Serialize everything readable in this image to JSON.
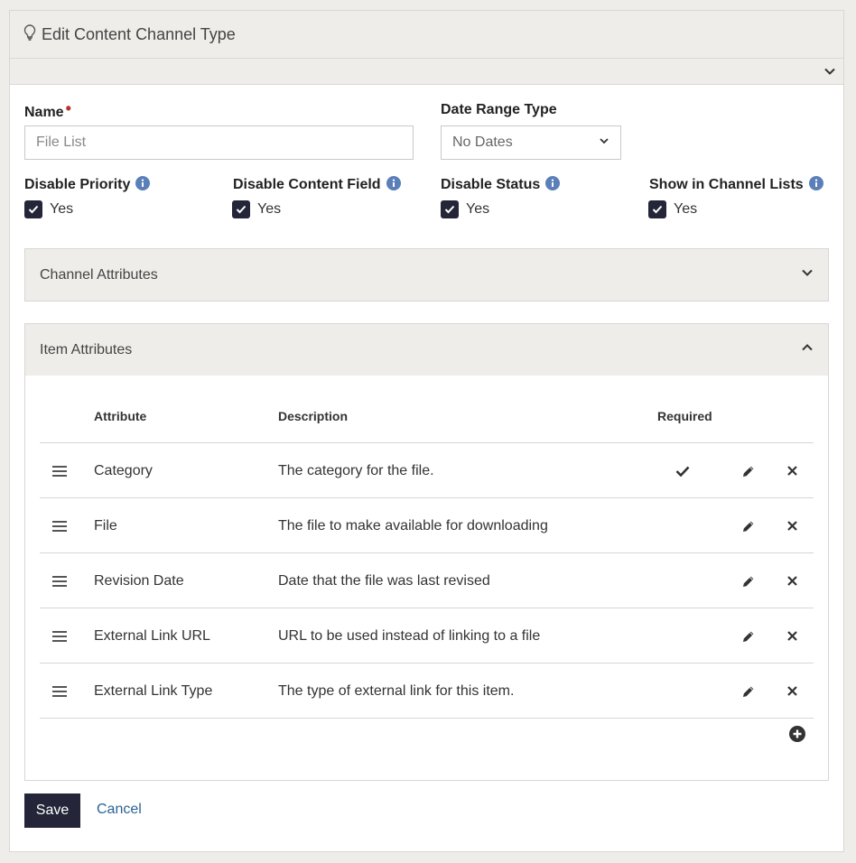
{
  "header": {
    "title": "Edit Content Channel Type",
    "icon": "lightbulb-icon"
  },
  "form": {
    "name_label": "Name",
    "name_placeholder": "File List",
    "date_range_label": "Date Range Type",
    "date_range_value": "No Dates",
    "toggles": [
      {
        "label": "Disable Priority",
        "value": "Yes"
      },
      {
        "label": "Disable Content Field",
        "value": "Yes"
      },
      {
        "label": "Disable Status",
        "value": "Yes"
      },
      {
        "label": "Show in Channel Lists",
        "value": "Yes"
      }
    ]
  },
  "channel_attributes": {
    "title": "Channel Attributes"
  },
  "item_attributes": {
    "title": "Item Attributes",
    "columns": {
      "attribute": "Attribute",
      "description": "Description",
      "required": "Required"
    },
    "rows": [
      {
        "attribute": "Category",
        "description": "The category for the file.",
        "required": true
      },
      {
        "attribute": "File",
        "description": "The file to make available for downloading",
        "required": false
      },
      {
        "attribute": "Revision Date",
        "description": "Date that the file was last revised",
        "required": false
      },
      {
        "attribute": "External Link URL",
        "description": "URL to be used instead of linking to a file",
        "required": false
      },
      {
        "attribute": "External Link Type",
        "description": "The type of external link for this item.",
        "required": false
      }
    ]
  },
  "actions": {
    "save": "Save",
    "cancel": "Cancel"
  },
  "colors": {
    "primary": "#242538",
    "link": "#2a6395",
    "info": "#5b7fb8",
    "required": "#b5342e"
  }
}
